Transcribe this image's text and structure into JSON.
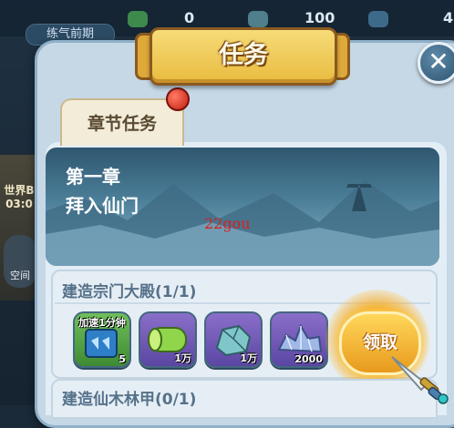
{
  "background_hud": {
    "pill_label": "练气前期",
    "resources": [
      "0",
      "100",
      "4"
    ],
    "left_label_1": "世界B",
    "left_label_2": "03:0",
    "left_button_label": "空间"
  },
  "panel": {
    "title": "任务",
    "tab_label": "章节任务"
  },
  "chapter": {
    "number": "第一章",
    "name": "拜入仙门",
    "watermark": "22gou"
  },
  "tasks": [
    {
      "title": "建造宗门大殿(1/1)",
      "rewards": [
        {
          "label": "加速1分钟",
          "count": "5",
          "icon": "speedup-book-icon"
        },
        {
          "label": "",
          "count": "1万",
          "icon": "wood-log-icon"
        },
        {
          "label": "",
          "count": "1万",
          "icon": "stone-icon"
        },
        {
          "label": "",
          "count": "2000",
          "icon": "crystal-ore-icon"
        }
      ],
      "claim_label": "领取"
    },
    {
      "title": "建造仙木林甲(0/1)"
    }
  ],
  "colors": {
    "banner": "#e9bb3f",
    "claim": "#f4b13a",
    "badge": "#c21f0f"
  }
}
